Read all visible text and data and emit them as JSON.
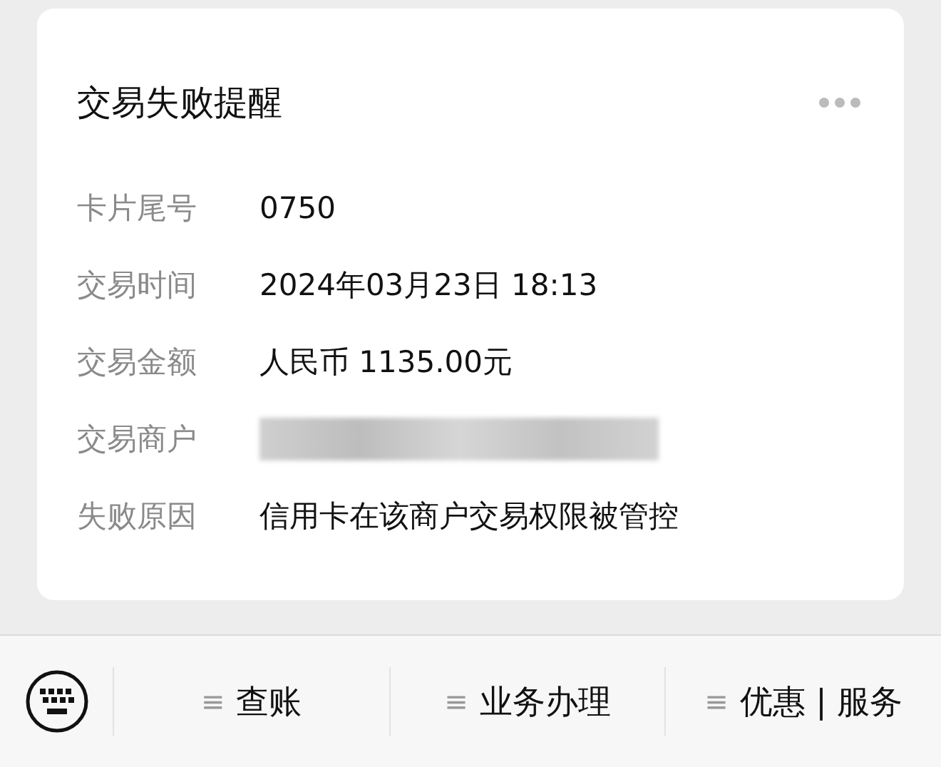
{
  "card": {
    "title": "交易失败提醒",
    "rows": [
      {
        "label": "卡片尾号",
        "kind": "text",
        "value": "0750"
      },
      {
        "label": "交易时间",
        "kind": "text",
        "value": "2024年03月23日 18:13"
      },
      {
        "label": "交易金额",
        "kind": "text",
        "value": "人民币 1135.00元"
      },
      {
        "label": "交易商户",
        "kind": "redacted"
      },
      {
        "label": "失败原因",
        "kind": "text",
        "value": "信用卡在该商户交易权限被管控"
      }
    ]
  },
  "menu": [
    {
      "icon": "≡",
      "label": "查账"
    },
    {
      "icon": "≡",
      "label": "业务办理"
    },
    {
      "icon": "≡",
      "label": "优惠 | 服务"
    }
  ]
}
